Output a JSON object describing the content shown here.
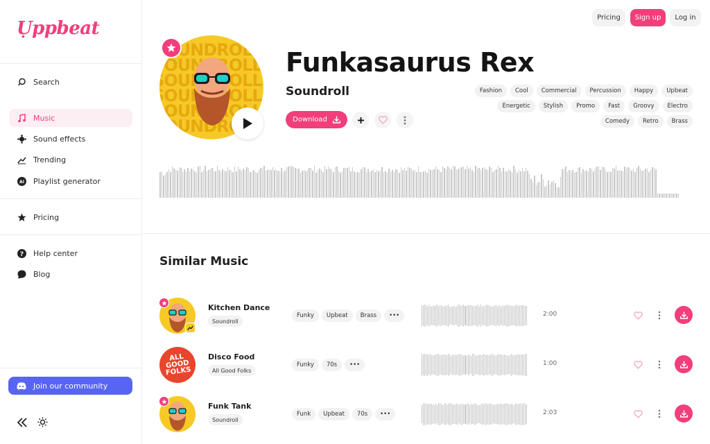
{
  "brand": {
    "logo_text": "Uppbeat",
    "accent": "#f23e7a",
    "discord": "#5865f2"
  },
  "sidebar": {
    "items": [
      {
        "label": "Search",
        "icon": "search-icon"
      },
      {
        "label": "Music",
        "icon": "music-note-icon",
        "active": true
      },
      {
        "label": "Sound effects",
        "icon": "sound-effects-icon"
      },
      {
        "label": "Trending",
        "icon": "trending-icon"
      },
      {
        "label": "Playlist generator",
        "icon": "ai-icon"
      },
      {
        "label": "Pricing",
        "icon": "star-icon"
      },
      {
        "label": "Help center",
        "icon": "help-icon"
      },
      {
        "label": "Blog",
        "icon": "blog-icon"
      }
    ],
    "community_label": "Join our community"
  },
  "header": {
    "pricing": "Pricing",
    "signup": "Sign up",
    "login": "Log in"
  },
  "track": {
    "title": "Funkasaurus Rex",
    "artist": "Soundroll",
    "cover_text": "SOUNDROLL",
    "download_label": "Download",
    "tags": [
      "Fashion",
      "Cool",
      "Commercial",
      "Percussion",
      "Happy",
      "Upbeat",
      "Energetic",
      "Stylish",
      "Promo",
      "Fast",
      "Groovy",
      "Electro",
      "Comedy",
      "Retro",
      "Brass"
    ]
  },
  "similar": {
    "title": "Similar Music",
    "rows": [
      {
        "title": "Kitchen Dance",
        "artist": "Soundroll",
        "tags": [
          "Funky",
          "Upbeat",
          "Brass"
        ],
        "duration": "2:00",
        "cover": "yellow"
      },
      {
        "title": "Disco Food",
        "artist": "All Good Folks",
        "tags": [
          "Funky",
          "70s"
        ],
        "duration": "1:00",
        "cover": "red",
        "cover_text": "ALL GOOD FOLKS"
      },
      {
        "title": "Funk Tank",
        "artist": "Soundroll",
        "tags": [
          "Funk",
          "Upbeat",
          "70s"
        ],
        "duration": "2:03",
        "cover": "yellow"
      }
    ]
  }
}
